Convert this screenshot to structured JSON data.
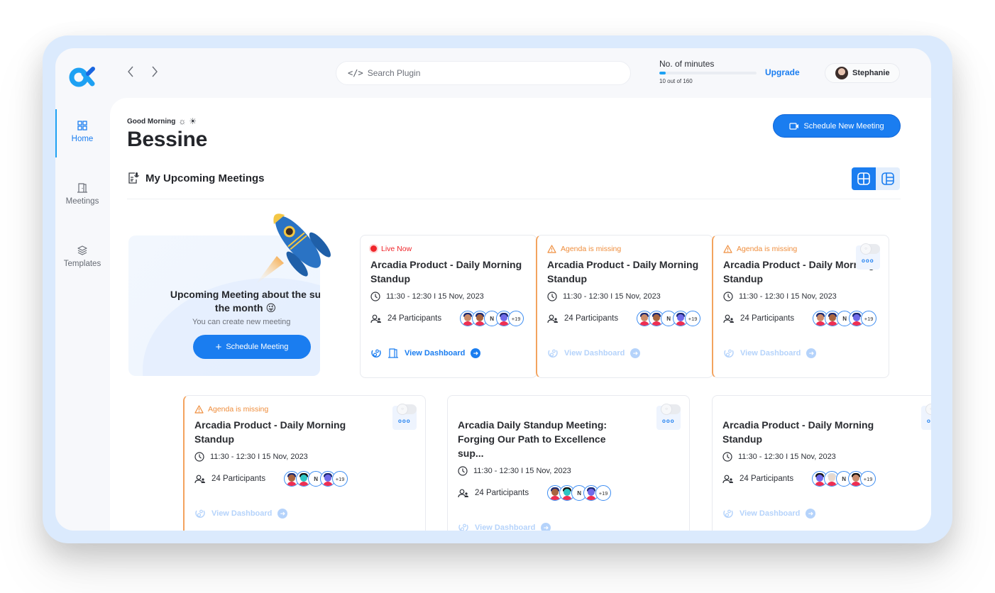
{
  "app": {
    "nav": {
      "back_label": "‹",
      "forward_label": "›"
    },
    "search": {
      "placeholder": "Search Plugin",
      "value": ""
    },
    "usage": {
      "label": "No. of minutes",
      "used": 10,
      "total": 160,
      "count_text": "10 out of 160",
      "fraction": 0.0625
    },
    "upgrade_label": "Upgrade",
    "user": {
      "name": "Stephanie"
    }
  },
  "sidebar": {
    "items": [
      {
        "label": "Home",
        "icon": "grid-icon",
        "active": true
      },
      {
        "label": "Meetings",
        "icon": "door-icon",
        "active": false
      },
      {
        "label": "Templates",
        "icon": "layers-icon",
        "active": false
      }
    ]
  },
  "header": {
    "greeting": "Good Morning",
    "user_title": "Bessine",
    "schedule_new_label": "Schedule New Meeting",
    "section_title": "My Upcoming Meetings"
  },
  "promo": {
    "title_line1": "Upcoming Meeting about the su",
    "title_line2": "the month 😜",
    "subtitle": "You can create new meeting",
    "button_label": "Schedule Meeting"
  },
  "cards": [
    {
      "status": "live",
      "status_label": "Live Now",
      "title": "Arcadia Product - Daily Morning Standup",
      "time": "11:30 - 12:30 I 15 Nov, 2023",
      "participants": "24 Participants",
      "avatar_initial": "N",
      "more": "+19",
      "dashboard_label": "View Dashboard",
      "dashboard_active": true,
      "toggle": false
    },
    {
      "status": "agenda",
      "status_label": "Agenda is missing",
      "title": "Arcadia Product - Daily Morning Standup",
      "time": "11:30 - 12:30 I 15 Nov, 2023",
      "participants": "24 Participants",
      "avatar_initial": "N",
      "more": "+19",
      "dashboard_label": "View Dashboard",
      "dashboard_active": false,
      "toggle": false
    },
    {
      "status": "agenda",
      "status_label": "Agenda is missing",
      "title": "Arcadia Product - Daily Morning Standup",
      "time": "11:30 - 12:30 I 15 Nov, 2023",
      "participants": "24 Participants",
      "avatar_initial": "N",
      "more": "+19",
      "dashboard_label": "View Dashboard",
      "dashboard_active": false,
      "toggle": true
    },
    {
      "status": "agenda",
      "status_label": "Agenda is missing",
      "title": "Arcadia Product - Daily Morning Standup",
      "time": "11:30 - 12:30 I 15 Nov, 2023",
      "participants": "24 Participants",
      "avatar_initial": "N",
      "more": "+19",
      "dashboard_label": "View Dashboard",
      "dashboard_active": false,
      "toggle": true
    },
    {
      "status": "none",
      "status_label": "",
      "title": "Arcadia Daily Standup Meeting: Forging Our Path to Excellence sup...",
      "time": "11:30 - 12:30 I 15 Nov, 2023",
      "participants": "24 Participants",
      "avatar_initial": "N",
      "more": "+19",
      "dashboard_label": "View Dashboard",
      "dashboard_active": false,
      "toggle": true
    },
    {
      "status": "none",
      "status_label": "",
      "title": "Arcadia Product - Daily Morning Standup",
      "time": "11:30 - 12:30 I 15 Nov, 2023",
      "participants": "24 Participants",
      "avatar_initial": "N",
      "more": "+19",
      "dashboard_label": "View Dashboard",
      "dashboard_active": false,
      "toggle": true
    }
  ],
  "colors": {
    "accent": "#1a7df0",
    "live": "#f0262b",
    "warning": "#ef8d3c",
    "frame": "#dbeafd"
  }
}
